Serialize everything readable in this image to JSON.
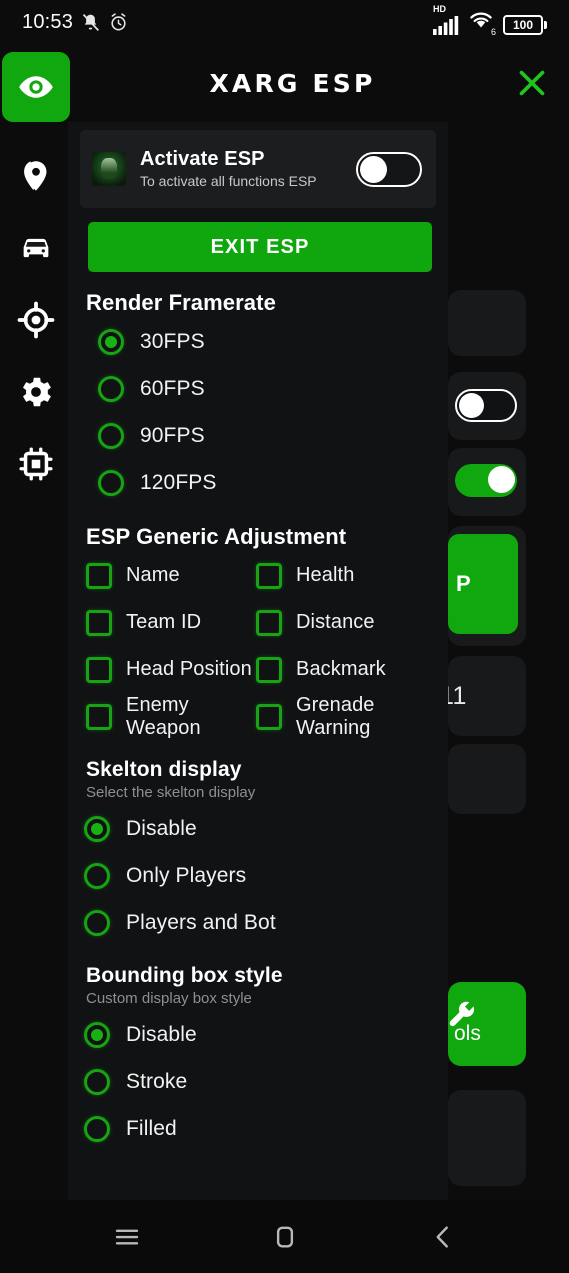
{
  "statusbar": {
    "clock": "10:53",
    "battery_level": "100",
    "icons": [
      "mute-bell-icon",
      "alarm-clock-icon",
      "hd-icon",
      "signal-bars-icon",
      "wifi-6-icon",
      "battery-icon"
    ]
  },
  "header": {
    "title": "XARG ESP",
    "close_label": "×"
  },
  "rail": {
    "items": [
      {
        "icon": "eye-icon",
        "active": true
      },
      {
        "icon": "location-pin-icon",
        "active": false
      },
      {
        "icon": "car-icon",
        "active": false
      },
      {
        "icon": "crosshair-target-icon",
        "active": false
      },
      {
        "icon": "gear-icon",
        "active": false
      },
      {
        "icon": "chip-cpu-icon",
        "active": false
      }
    ]
  },
  "activate_card": {
    "title": "Activate ESP",
    "subtitle": "To activate all functions ESP",
    "toggle_state": "off"
  },
  "exit_button": {
    "label": "EXIT ESP"
  },
  "sections": {
    "framerate": {
      "heading": "Render Framerate",
      "options": [
        {
          "label": "30FPS",
          "selected": true
        },
        {
          "label": "60FPS",
          "selected": false
        },
        {
          "label": "90FPS",
          "selected": false
        },
        {
          "label": "120FPS",
          "selected": false
        }
      ]
    },
    "generic": {
      "heading": "ESP Generic Adjustment",
      "checkboxes": [
        {
          "label": "Name",
          "checked": false
        },
        {
          "label": "Health",
          "checked": false
        },
        {
          "label": "Team ID",
          "checked": false
        },
        {
          "label": "Distance",
          "checked": false
        },
        {
          "label": "Head Position",
          "checked": false
        },
        {
          "label": "Backmark",
          "checked": false
        },
        {
          "label": "Enemy Weapon",
          "checked": false
        },
        {
          "label": "Grenade Warning",
          "checked": false
        }
      ]
    },
    "skelton": {
      "heading": "Skelton display",
      "subheading": "Select the skelton display",
      "options": [
        {
          "label": "Disable",
          "selected": true
        },
        {
          "label": "Only Players",
          "selected": false
        },
        {
          "label": "Players and Bot",
          "selected": false
        }
      ]
    },
    "bounding": {
      "heading": "Bounding box style",
      "subheading": "Custom display box style",
      "options": [
        {
          "label": "Disable",
          "selected": true
        },
        {
          "label": "Stroke",
          "selected": false
        },
        {
          "label": "Filled",
          "selected": false
        }
      ]
    }
  },
  "background": {
    "partial_green_button_label": "P",
    "partial_text": "11",
    "tools_label": "ols",
    "toggles": [
      {
        "state": "off"
      },
      {
        "state": "on"
      }
    ]
  },
  "navbar": {
    "items": [
      "recents-icon",
      "home-icon",
      "back-icon"
    ]
  },
  "colors": {
    "accent_green": "#10a80e",
    "panel_bg": "#111214",
    "card_bg": "#1b1d1f",
    "page_bg": "#0c0c0c",
    "text_primary": "#ffffff",
    "text_secondary": "#8d9092"
  }
}
